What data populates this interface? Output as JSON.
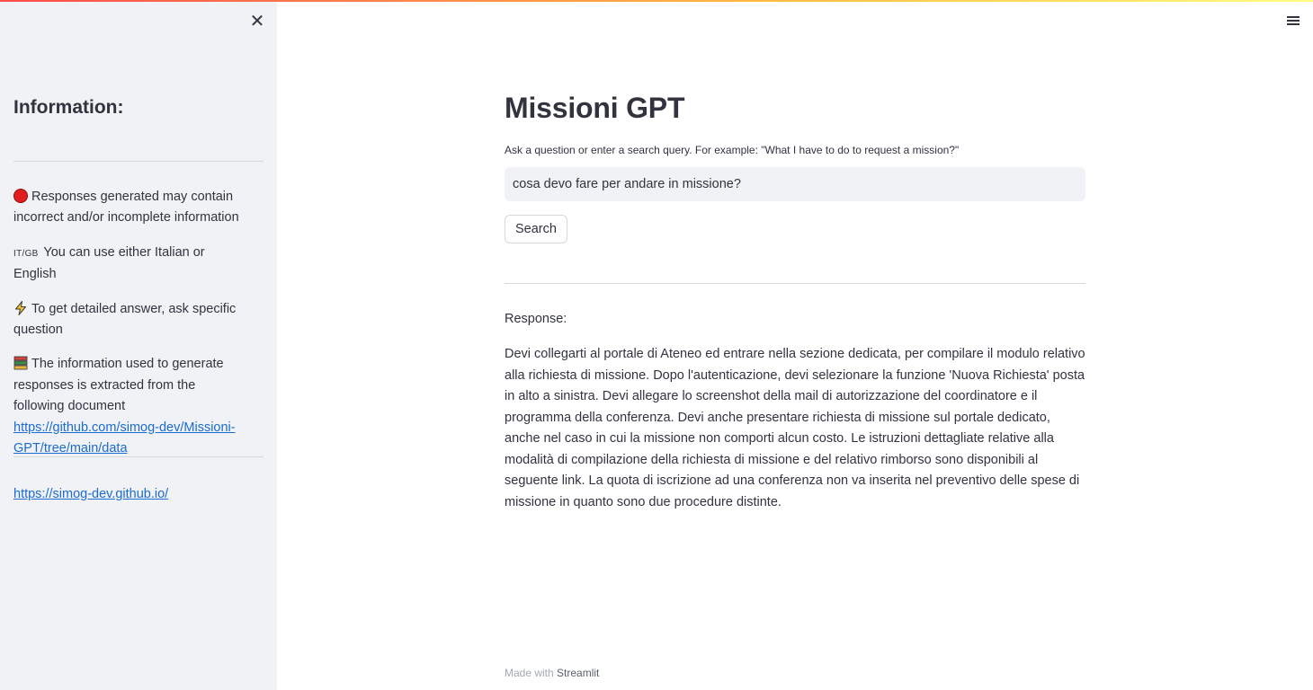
{
  "sidebar": {
    "close_icon": "close-icon",
    "heading": "Information:",
    "notes": {
      "disclaimer": "Responses generated may contain incorrect and/or incomplete information",
      "flags": "IT/GB",
      "language": "You can use either Italian or English",
      "tip": "To get detailed answer, ask specific question",
      "source_text": "The information used to generate responses is extracted from the following document",
      "source_link": "https://github.com/simog-dev/Missioni-GPT/tree/main/data"
    },
    "site_link": "https://simog-dev.github.io/"
  },
  "header": {
    "menu_icon": "hamburger-menu-icon"
  },
  "main": {
    "title": "Missioni GPT",
    "input_label": "Ask a question or enter a search query. For example: \"What I have to do to request a mission?\"",
    "input_value": "cosa devo fare per andare in missione?",
    "search_button": "Search",
    "response_label": "Response:",
    "response_text": "Devi collegarti al portale di Ateneo ed entrare nella sezione dedicata, per compilare il modulo relativo alla richiesta di missione. Dopo l'autenticazione, devi selezionare la funzione 'Nuova Richiesta' posta in alto a sinistra. Devi allegare lo screenshot della mail di autorizzazione del coordinatore e il programma della conferenza. Devi anche presentare richiesta di missione sul portale dedicato, anche nel caso in cui la missione non comporti alcun costo. Le istruzioni dettagliate relative alla modalità di compilazione della richiesta di missione e del relativo rimborso sono disponibili al seguente link. La quota di iscrizione ad una conferenza non va inserita nel preventivo delle spese di missione in quanto sono due procedure distinte."
  },
  "footer": {
    "made_with": "Made with",
    "brand": "Streamlit"
  },
  "colors": {
    "sidebar_bg": "#f0f2f6",
    "text": "#31333f",
    "link": "#1c6bd1",
    "accent_red": "#ff4b4b"
  }
}
